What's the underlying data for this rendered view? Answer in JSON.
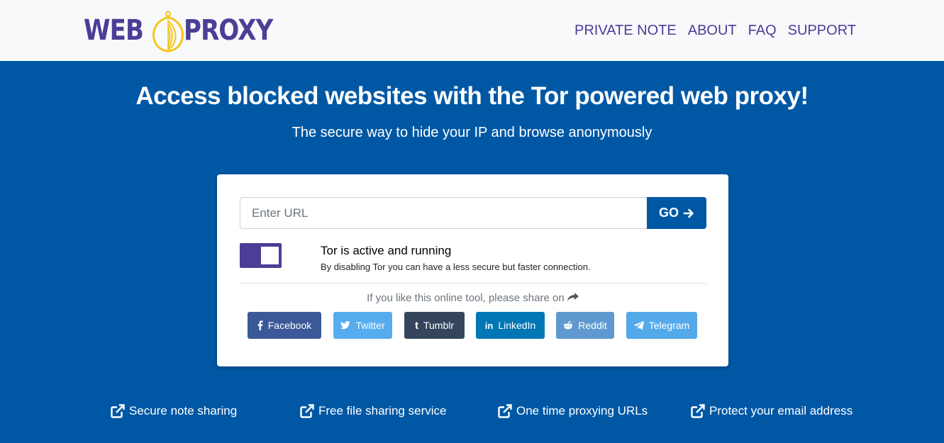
{
  "header": {
    "logo_left": "WEB",
    "logo_right": "PROXY",
    "nav": [
      "PRIVATE NOTE",
      "ABOUT",
      "FAQ",
      "SUPPORT"
    ]
  },
  "hero": {
    "title": "Access blocked websites with the Tor powered web proxy!",
    "subtitle": "The secure way to hide your IP and browse anonymously"
  },
  "form": {
    "url_placeholder": "Enter URL",
    "url_value": "",
    "go_label": "GO",
    "tor_status": "Tor is active and running",
    "tor_description": "By disabling Tor you can have a less secure but faster connection."
  },
  "share": {
    "prompt": "If you like this online tool, please share on",
    "buttons": [
      {
        "label": "Facebook",
        "icon": "facebook-icon",
        "color": "#3b5998"
      },
      {
        "label": "Twitter",
        "icon": "twitter-icon",
        "color": "#55acee"
      },
      {
        "label": "Tumblr",
        "icon": "tumblr-icon",
        "color": "#35465c"
      },
      {
        "label": "LinkedIn",
        "icon": "linkedin-icon",
        "color": "#0077b5"
      },
      {
        "label": "Reddit",
        "icon": "reddit-icon",
        "color": "#5f99cf"
      },
      {
        "label": "Telegram",
        "icon": "telegram-icon",
        "color": "#54a9eb"
      }
    ]
  },
  "features": [
    "Secure note sharing",
    "Free file sharing service",
    "One time proxying URLs",
    "Protect your email address"
  ],
  "colors": {
    "primary": "#0058a5",
    "brand": "#4a3e96",
    "logo_onion": "#f5c518"
  }
}
